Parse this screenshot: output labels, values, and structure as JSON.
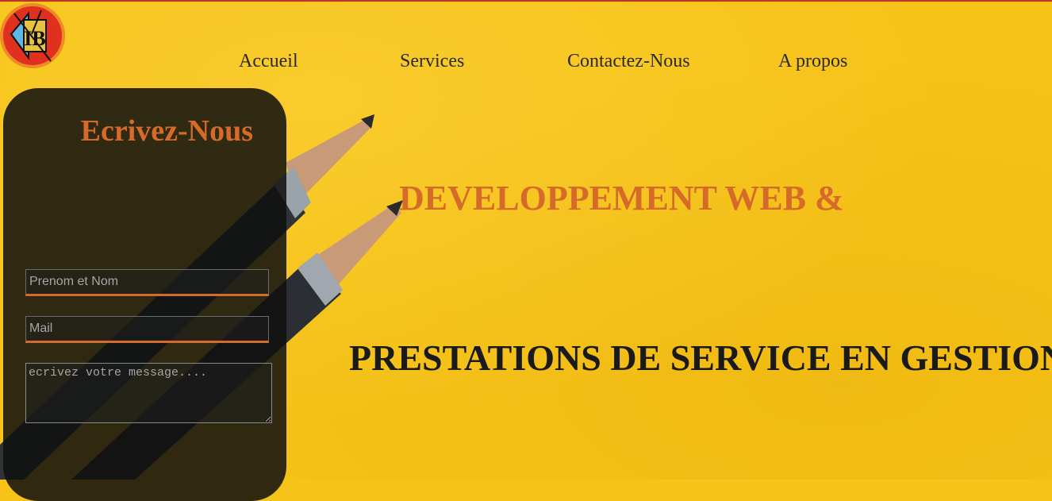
{
  "nav": {
    "items": [
      {
        "label": "Accueil"
      },
      {
        "label": "Services"
      },
      {
        "label": "Contactez-Nous"
      },
      {
        "label": "A propos"
      }
    ]
  },
  "contact": {
    "title": "Ecrivez-Nous",
    "name_placeholder": "Prenom et Nom",
    "mail_placeholder": "Mail",
    "message_placeholder": "ecrivez votre message...."
  },
  "hero": {
    "line1": "DEVELOPPEMENT WEB &",
    "line2": "PRESTATIONS DE SERVICE EN GESTION"
  },
  "logo": {
    "letters": "IB"
  },
  "colors": {
    "background": "#f6c319",
    "accent": "#d56a2a",
    "panel": "#0f0f0f",
    "top_border": "#c8302a"
  }
}
